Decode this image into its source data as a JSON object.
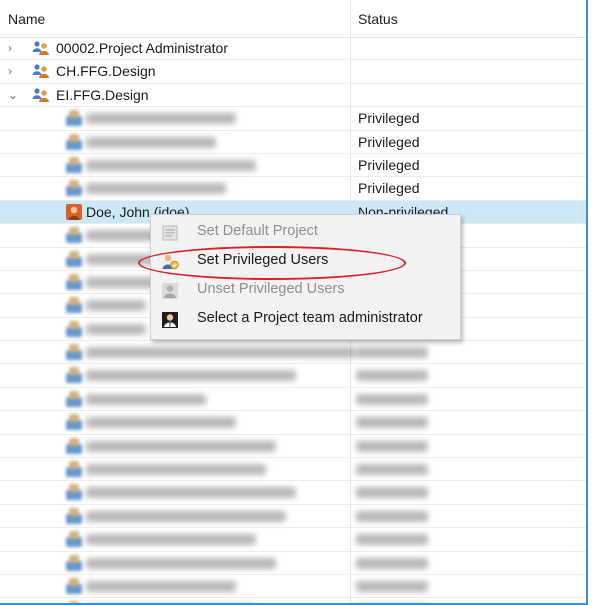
{
  "columns": {
    "name": "Name",
    "status": "Status"
  },
  "groups": [
    {
      "label": "00002.Project Administrator",
      "expanded": false
    },
    {
      "label": "CH.FFG.Design",
      "expanded": false
    },
    {
      "label": "EI.FFG.Design",
      "expanded": true
    }
  ],
  "users": [
    {
      "status": "Privileged",
      "blur_width": 150
    },
    {
      "status": "Privileged",
      "blur_width": 130
    },
    {
      "status": "Privileged",
      "blur_width": 170
    },
    {
      "status": "Privileged",
      "blur_width": 140
    },
    {
      "name": "Doe, John (jdoe)",
      "status": "Non-privileged",
      "selected": true
    },
    {
      "blur_width": 70
    },
    {
      "blur_width": 80
    },
    {
      "blur_width": 70
    },
    {
      "blur_width": 60
    },
    {
      "blur_width": 60
    },
    {
      "blur_width": 270,
      "status_blurred": true
    },
    {
      "blur_width": 210,
      "status_blurred": true
    },
    {
      "blur_width": 120,
      "status_blurred": true
    },
    {
      "blur_width": 150,
      "status_blurred": true
    },
    {
      "blur_width": 190,
      "status_blurred": true
    },
    {
      "blur_width": 180,
      "status_blurred": true
    },
    {
      "blur_width": 210,
      "status_blurred": true
    },
    {
      "blur_width": 200,
      "status_blurred": true
    },
    {
      "blur_width": 170,
      "status_blurred": true
    },
    {
      "blur_width": 190,
      "status_blurred": true
    },
    {
      "blur_width": 150,
      "status_blurred": true
    },
    {
      "blur_width": 170,
      "status_blurred": true
    }
  ],
  "context_menu": {
    "items": [
      {
        "label": "Set Default Project",
        "enabled": false,
        "icon": "default-project-icon"
      },
      {
        "label": "Set Privileged Users",
        "enabled": true,
        "icon": "privileged-users-icon",
        "highlighted": true
      },
      {
        "label": "Unset Privileged Users",
        "enabled": false,
        "icon": "unset-privileged-icon"
      },
      {
        "label": "Select a Project team administrator",
        "enabled": true,
        "icon": "team-admin-icon"
      }
    ]
  },
  "colors": {
    "selection": "#cce8f6",
    "callout": "#d8212a",
    "frame": "#3c8ed4"
  }
}
